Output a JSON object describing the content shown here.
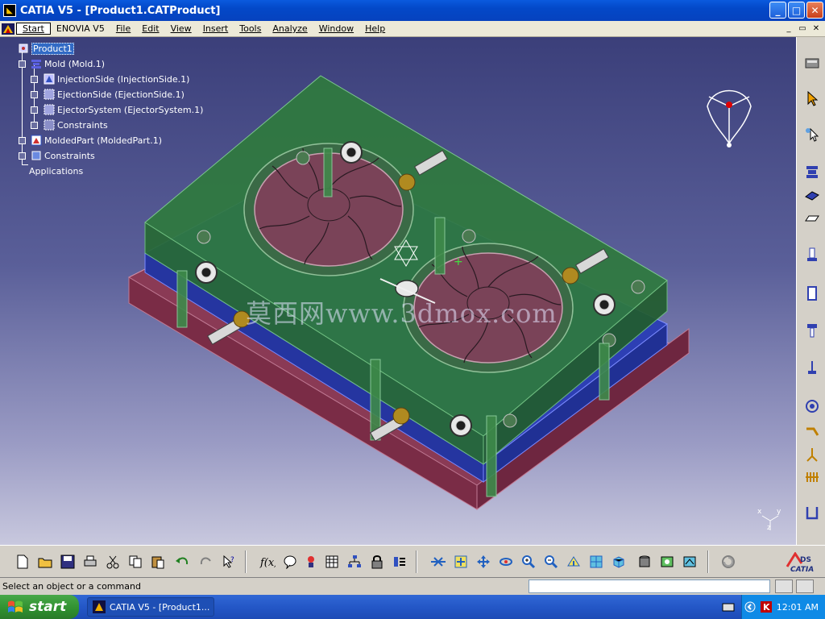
{
  "window": {
    "title": "CATIA V5 - [Product1.CATProduct]",
    "controls": {
      "minimize": "_",
      "maximize": "□",
      "close": "✕"
    }
  },
  "menu": {
    "items": [
      "Start",
      "ENOVIA V5",
      "File",
      "Edit",
      "View",
      "Insert",
      "Tools",
      "Analyze",
      "Window",
      "Help"
    ],
    "mdi": {
      "minimize": "_",
      "restore": "▭",
      "close": "✕"
    }
  },
  "tree": {
    "root": "Product1",
    "nodes": [
      {
        "label": "Mold (Mold.1)"
      },
      {
        "label": "InjectionSide (InjectionSide.1)"
      },
      {
        "label": "EjectionSide (EjectionSide.1)"
      },
      {
        "label": "EjectorSystem (EjectorSystem.1)"
      },
      {
        "label": "Constraints"
      },
      {
        "label": "MoldedPart (MoldedPart.1)"
      },
      {
        "label": "Constraints"
      },
      {
        "label": "Applications"
      }
    ]
  },
  "viewport": {
    "watermark": "莫西网www.3dmox.com",
    "axis_labels": {
      "x": "x",
      "y": "y",
      "z": "z"
    }
  },
  "right_toolbar": {
    "icons": [
      "device-icon",
      "select-arrow-icon",
      "select-mode-icon",
      "mold-base-icon",
      "plate-icon",
      "slider-icon",
      "bolt-icon",
      "pillar-icon",
      "screw-icon",
      "ejector-pin-icon",
      "sprue-icon",
      "runner-icon",
      "cooling-icon",
      "baffle-icon",
      "u-channel-icon"
    ]
  },
  "bottom_toolbar": {
    "icons": [
      "new-icon",
      "open-icon",
      "save-icon",
      "print-icon",
      "cut-icon",
      "copy-icon",
      "paste-icon",
      "undo-icon",
      "redo-icon",
      "whats-this-icon",
      "formula-icon",
      "comment-icon",
      "knowledge-icon",
      "table-icon",
      "tree-icon",
      "lock-icon",
      "catalog-icon",
      "fly-icon",
      "fit-all-icon",
      "pan-icon",
      "rotate-icon",
      "zoom-in-icon",
      "zoom-out-icon",
      "normal-view-icon",
      "multi-view-icon",
      "iso-view-icon",
      "shading-icon",
      "hide-show-icon",
      "swap-visible-icon",
      "update-icon"
    ],
    "brand": "CATIA"
  },
  "status": {
    "message": "Select an object or a command",
    "command_placeholder": ""
  },
  "taskbar": {
    "start": "start",
    "task": "CATIA V5 - [Product1...",
    "clock": "12:01 AM"
  }
}
